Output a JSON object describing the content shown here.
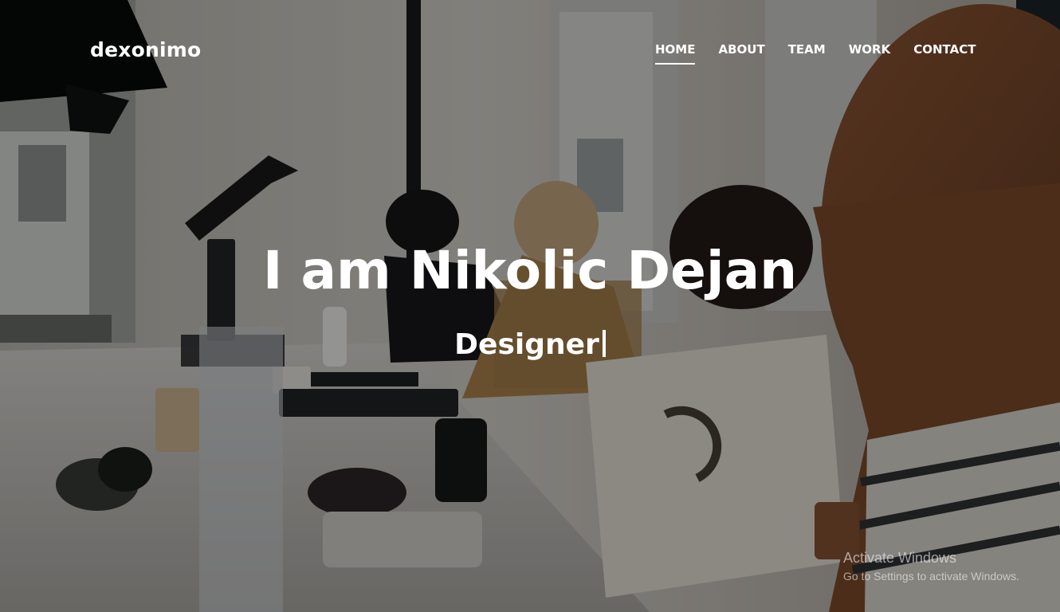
{
  "brand": {
    "name": "dexonimo"
  },
  "nav": {
    "items": [
      {
        "label": "HOME",
        "active": true
      },
      {
        "label": "ABOUT",
        "active": false
      },
      {
        "label": "TEAM",
        "active": false
      },
      {
        "label": "WORK",
        "active": false
      },
      {
        "label": "CONTACT",
        "active": false
      }
    ]
  },
  "hero": {
    "title": "I am Nikolic Dejan",
    "subtitle": "Designer"
  },
  "watermark": {
    "title": "Activate Windows",
    "subtitle": "Go to Settings to activate Windows."
  },
  "colors": {
    "text": "#ffffff",
    "overlay": "#000000"
  }
}
